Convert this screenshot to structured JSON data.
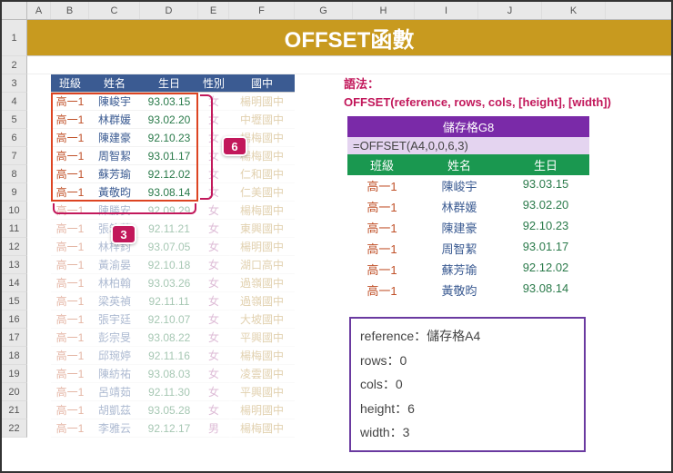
{
  "title": "OFFSET函數",
  "columns": [
    "A",
    "B",
    "C",
    "D",
    "E",
    "F",
    "G",
    "H",
    "I",
    "J",
    "K"
  ],
  "rowNumbers": [
    1,
    2,
    3,
    4,
    5,
    6,
    7,
    8,
    9,
    10,
    11,
    12,
    13,
    14,
    15,
    16,
    17,
    18,
    19,
    20,
    21,
    22
  ],
  "table": {
    "headers": {
      "class": "班級",
      "name": "姓名",
      "date": "生日",
      "sex": "性別",
      "school": "國中"
    },
    "rows": [
      {
        "class": "高一1",
        "name": "陳峻宇",
        "date": "93.03.15",
        "sex": "女",
        "school": "楊明國中"
      },
      {
        "class": "高一1",
        "name": "林群媛",
        "date": "93.02.20",
        "sex": "女",
        "school": "中壢國中"
      },
      {
        "class": "高一1",
        "name": "陳建豪",
        "date": "92.10.23",
        "sex": "女",
        "school": "楊梅國中"
      },
      {
        "class": "高一1",
        "name": "周智絜",
        "date": "93.01.17",
        "sex": "女",
        "school": "楊梅國中"
      },
      {
        "class": "高一1",
        "name": "蘇芳瑜",
        "date": "92.12.02",
        "sex": "女",
        "school": "仁和國中"
      },
      {
        "class": "高一1",
        "name": "黃敬昀",
        "date": "93.08.14",
        "sex": "女",
        "school": "仁美國中"
      },
      {
        "class": "高一1",
        "name": "陳勝安",
        "date": "92.09.29",
        "sex": "女",
        "school": "楊梅國中"
      },
      {
        "class": "高一1",
        "name": "張筑華",
        "date": "92.11.21",
        "sex": "女",
        "school": "東興國中"
      },
      {
        "class": "高一1",
        "name": "林梓鈞",
        "date": "93.07.05",
        "sex": "女",
        "school": "楊明國中"
      },
      {
        "class": "高一1",
        "name": "黃渝晏",
        "date": "92.10.18",
        "sex": "女",
        "school": "湖口高中"
      },
      {
        "class": "高一1",
        "name": "林柏翰",
        "date": "93.03.26",
        "sex": "女",
        "school": "過嶺國中"
      },
      {
        "class": "高一1",
        "name": "梁英禎",
        "date": "92.11.11",
        "sex": "女",
        "school": "過嶺國中"
      },
      {
        "class": "高一1",
        "name": "張宇廷",
        "date": "92.10.07",
        "sex": "女",
        "school": "大坡國中"
      },
      {
        "class": "高一1",
        "name": "彭宗旻",
        "date": "93.08.22",
        "sex": "女",
        "school": "平興國中"
      },
      {
        "class": "高一1",
        "name": "邱琬婷",
        "date": "92.11.16",
        "sex": "女",
        "school": "楊梅國中"
      },
      {
        "class": "高一1",
        "name": "陳紡祐",
        "date": "93.08.03",
        "sex": "女",
        "school": "凌雲國中"
      },
      {
        "class": "高一1",
        "name": "呂靖茹",
        "date": "92.11.30",
        "sex": "女",
        "school": "平興國中"
      },
      {
        "class": "高一1",
        "name": "胡凱茲",
        "date": "93.05.28",
        "sex": "女",
        "school": "楊明國中"
      },
      {
        "class": "高一1",
        "name": "李雅云",
        "date": "92.12.17",
        "sex": "男",
        "school": "楊梅國中"
      }
    ]
  },
  "syntax": {
    "label": "語法：",
    "text": "OFFSET(reference, rows, cols, [height], [width])"
  },
  "resultBox": {
    "cellRef": "儲存格G8",
    "formula": "=OFFSET(A4,0,0,6,3)",
    "headers": {
      "class": "班級",
      "name": "姓名",
      "date": "生日"
    },
    "rows": [
      {
        "class": "高一1",
        "name": "陳峻宇",
        "date": "93.03.15"
      },
      {
        "class": "高一1",
        "name": "林群媛",
        "date": "93.02.20"
      },
      {
        "class": "高一1",
        "name": "陳建豪",
        "date": "92.10.23"
      },
      {
        "class": "高一1",
        "name": "周智絜",
        "date": "93.01.17"
      },
      {
        "class": "高一1",
        "name": "蘇芳瑜",
        "date": "92.12.02"
      },
      {
        "class": "高一1",
        "name": "黃敬昀",
        "date": "93.08.14"
      }
    ]
  },
  "info": {
    "l1": "reference：儲存格A4",
    "l2": "rows：0",
    "l3": "cols：0",
    "l4": "height：6",
    "l5": "width：3"
  },
  "badges": {
    "height": "6",
    "width": "3"
  }
}
